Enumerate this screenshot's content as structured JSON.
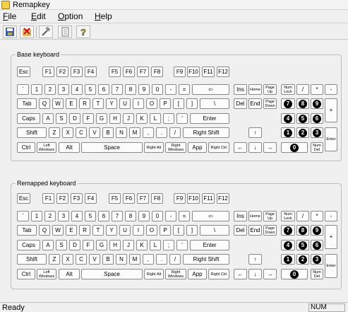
{
  "window": {
    "title": "Remapkey"
  },
  "menu": [
    {
      "label": "File",
      "underline": "F",
      "rest": "ile"
    },
    {
      "label": "Edit",
      "underline": "E",
      "rest": "dit"
    },
    {
      "label": "Option",
      "underline": "O",
      "rest": "ption"
    },
    {
      "label": "Help",
      "underline": "H",
      "rest": "elp"
    }
  ],
  "toolbar": {
    "buttons": [
      {
        "name": "save-tool-button",
        "icon": "floppy-disk-icon"
      },
      {
        "name": "reset-tool-button",
        "icon": "red-x-icon"
      },
      {
        "name": "edit-tool-button",
        "icon": "hammer-icon"
      },
      {
        "name": "view-tool-button",
        "icon": "document-icon"
      },
      {
        "name": "help-tool-button",
        "icon": "question-mark-icon"
      }
    ]
  },
  "keyboards": [
    {
      "id": "base",
      "label": "Base keyboard"
    },
    {
      "id": "remapped",
      "label": "Remapped keyboard"
    }
  ],
  "keys": {
    "esc": "Esc",
    "f1": "F1",
    "f2": "F2",
    "f3": "F3",
    "f4": "F4",
    "f5": "F5",
    "f6": "F6",
    "f7": "F7",
    "f8": "F8",
    "f9": "F9",
    "f10": "F10",
    "f11": "F11",
    "f12": "F12",
    "backtick": "`",
    "k1": "1",
    "k2": "2",
    "k3": "3",
    "k4": "4",
    "k5": "5",
    "k6": "6",
    "k7": "7",
    "k8": "8",
    "k9": "9",
    "k0": "0",
    "minus": "-",
    "equals": "=",
    "backspace": "⇦",
    "tab": "Tab",
    "q": "Q",
    "w": "W",
    "e": "E",
    "r": "R",
    "t": "T",
    "y": "Y",
    "u": "U",
    "i": "I",
    "o": "O",
    "p": "P",
    "lbracket": "[",
    "rbracket": "]",
    "backslash": "\\",
    "caps": "Caps",
    "a": "A",
    "s": "S",
    "d": "D",
    "f": "F",
    "g": "G",
    "h": "H",
    "j": "J",
    "k": "K",
    "l": "L",
    "semicolon": ";",
    "quote": "'",
    "enter": "Enter",
    "lshift": "Shift",
    "z": "Z",
    "x": "X",
    "c": "C",
    "v": "V",
    "b": "B",
    "n": "N",
    "m": "M",
    "comma": ",",
    "period": ".",
    "slash": "/",
    "rshift": "Right Shift",
    "lctrl": "Ctrl",
    "lwin": "Left Windows",
    "alt": "Alt",
    "space": "Space",
    "ralt": "Right Alt",
    "rwin": "Right Windows",
    "app": "App",
    "rctrl": "Right Ctrl",
    "ins": "Ins",
    "home": "Home",
    "pgup": "Page Up",
    "del": "Del",
    "end": "End",
    "pgdn": "Page Down",
    "up": "↑",
    "left": "←",
    "down": "↓",
    "right": "→",
    "numlock": "Num Lock",
    "npdiv": "/",
    "npmul": "*",
    "npminus": "-",
    "np7": "7",
    "np8": "8",
    "np9": "9",
    "npplus": "+",
    "np4": "4",
    "np5": "5",
    "np6": "6",
    "np1": "1",
    "np2": "2",
    "np3": "3",
    "npenter": "Enter",
    "np0": "0",
    "npdel": "Num Del"
  },
  "status": {
    "text": "Ready",
    "num": "NUM"
  }
}
